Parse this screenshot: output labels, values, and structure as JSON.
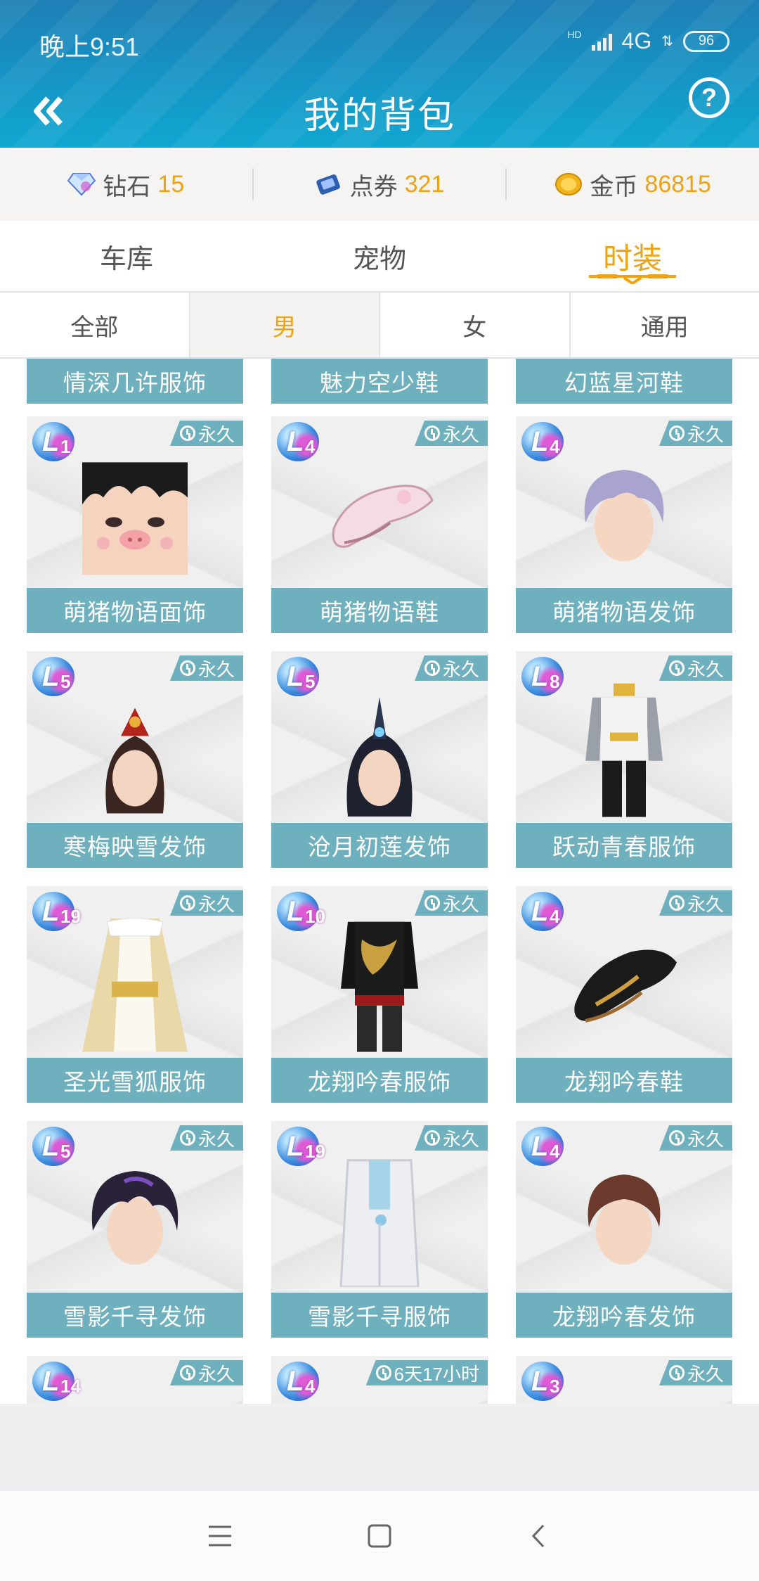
{
  "status": {
    "time": "晚上9:51",
    "network": "4G",
    "battery": "96",
    "hd": "HD"
  },
  "header": {
    "title": "我的背包"
  },
  "currency": [
    {
      "name": "钻石",
      "amount": "15",
      "icon": "diamond-icon"
    },
    {
      "name": "点券",
      "amount": "321",
      "icon": "ticket-icon"
    },
    {
      "name": "金币",
      "amount": "86815",
      "icon": "coin-icon"
    }
  ],
  "main_tabs": [
    {
      "label": "车库",
      "active": false
    },
    {
      "label": "宠物",
      "active": false
    },
    {
      "label": "时装",
      "active": true
    }
  ],
  "sub_tabs": [
    {
      "label": "全部",
      "active": false
    },
    {
      "label": "男",
      "active": true
    },
    {
      "label": "女",
      "active": false
    },
    {
      "label": "通用",
      "active": false
    }
  ],
  "partial_top_labels": [
    "情深几许服饰",
    "魅力空少鞋",
    "幻蓝星河鞋"
  ],
  "items": [
    {
      "name": "萌猪物语面饰",
      "level": "1",
      "duration": "永久",
      "art": "face"
    },
    {
      "name": "萌猪物语鞋",
      "level": "4",
      "duration": "永久",
      "art": "shoe-pink"
    },
    {
      "name": "萌猪物语发饰",
      "level": "4",
      "duration": "永久",
      "art": "hair-lilac"
    },
    {
      "name": "寒梅映雪发饰",
      "level": "5",
      "duration": "永久",
      "art": "hair-crown"
    },
    {
      "name": "沧月初莲发饰",
      "level": "5",
      "duration": "永久",
      "art": "hair-dark"
    },
    {
      "name": "跃动青春服饰",
      "level": "8",
      "duration": "永久",
      "art": "outfit-sport"
    },
    {
      "name": "圣光雪狐服饰",
      "level": "19",
      "duration": "永久",
      "art": "outfit-gold"
    },
    {
      "name": "龙翔吟春服饰",
      "level": "10",
      "duration": "永久",
      "art": "outfit-black"
    },
    {
      "name": "龙翔吟春鞋",
      "level": "4",
      "duration": "永久",
      "art": "shoe-black"
    },
    {
      "name": "雪影千寻发饰",
      "level": "5",
      "duration": "永久",
      "art": "hair-purple"
    },
    {
      "name": "雪影千寻服饰",
      "level": "19",
      "duration": "永久",
      "art": "outfit-white"
    },
    {
      "name": "龙翔吟春发饰",
      "level": "4",
      "duration": "永久",
      "art": "hair-brown"
    }
  ],
  "partial_bottom": [
    {
      "level": "14",
      "duration": "永久"
    },
    {
      "level": "4",
      "duration": "6天17小时"
    },
    {
      "level": "3",
      "duration": "永久"
    }
  ]
}
